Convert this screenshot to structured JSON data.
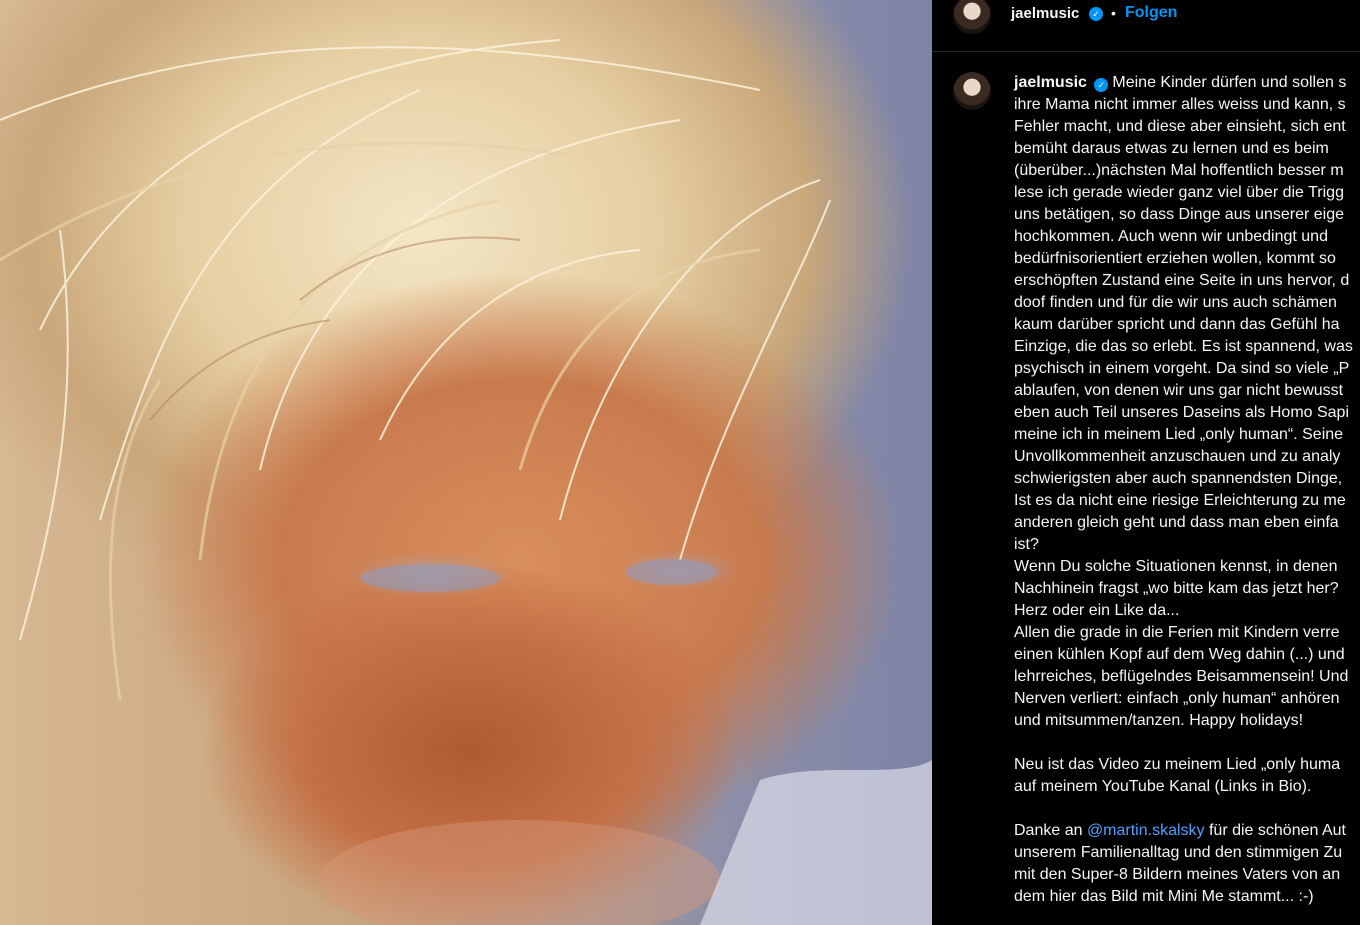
{
  "post": {
    "username": "jaelmusic",
    "verified_icon": "verified-badge-icon",
    "separator": "•",
    "follow_label": "Folgen",
    "colors": {
      "accent": "#0095f6",
      "background": "#000000",
      "text": "#f5f5f5",
      "mention": "#4ea1ff"
    }
  },
  "caption": {
    "username": "jaelmusic",
    "lines": [
      "Meine Kinder dürfen und sollen s",
      "ihre Mama nicht immer alles weiss und kann, s",
      "Fehler macht, und diese aber einsieht, sich ent",
      "bemüht daraus etwas zu lernen und es beim",
      "(überüber...)nächsten Mal hoffentlich besser m",
      "lese ich gerade wieder ganz viel über die Trigg",
      "uns betätigen, so dass Dinge aus unserer eige",
      "hochkommen. Auch wenn wir unbedingt und",
      "bedürfnisorientiert erziehen wollen, kommt so",
      "erschöpften Zustand eine Seite in uns hervor, d",
      "doof finden und für die wir uns auch schämen",
      "kaum darüber spricht und dann das Gefühl ha",
      "Einzige, die das so erlebt. Es ist spannend, was",
      "psychisch in einem vorgeht. Da sind so viele „P",
      "ablaufen, von denen wir uns gar nicht bewusst",
      "eben auch Teil unseres Daseins als Homo Sapi",
      "meine ich in meinem Lied „only human“. Seine",
      "Unvollkommenheit anzuschauen und zu analy",
      "schwierigsten aber auch spannendsten Dinge,",
      "Ist es da nicht eine riesige Erleichterung zu me",
      "anderen gleich geht und dass man eben einfa",
      "ist?",
      "Wenn Du solche Situationen kennst, in denen",
      "Nachhinein fragst „wo bitte kam das jetzt her?",
      "Herz oder ein Like da...",
      "Allen die grade in die Ferien mit Kindern verre",
      "einen kühlen Kopf auf dem Weg dahin (...) und",
      "lehrreiches, beflügelndes Beisammensein! Und",
      "Nerven verliert: einfach „only human“ anhören",
      "und mitsummen/tanzen. Happy holidays!",
      "",
      "Neu ist das Video zu meinem Lied „only huma",
      "auf meinem YouTube Kanal (Links in Bio).",
      ""
    ],
    "thanks_prefix": "Danke an ",
    "mention": "@martin.skalsky",
    "thanks_suffix": " für die schönen Aut",
    "tail_lines": [
      "unserem Familienalltag und den stimmigen Zu",
      "mit den Super-8 Bildern meines Vaters von an",
      "dem hier das Bild mit Mini Me stammt... :-)"
    ]
  }
}
